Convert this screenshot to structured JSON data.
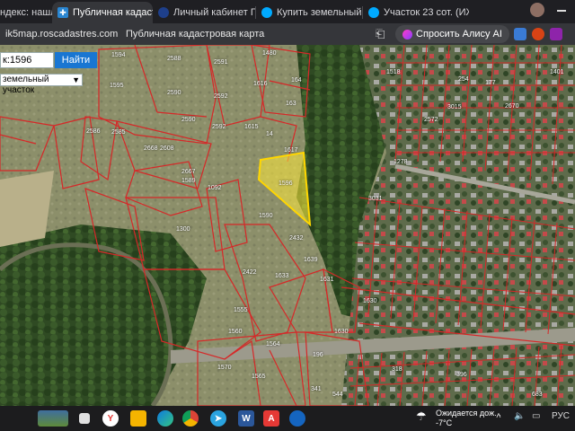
{
  "browser": {
    "tabs": [
      {
        "label": "ндекс: нашл",
        "active": false
      },
      {
        "label": "Публичная кадаст",
        "active": true
      },
      {
        "label": "Личный кабинет ПА",
        "active": false
      },
      {
        "label": "Купить земельный у",
        "active": false
      },
      {
        "label": "Участок 23 сот. (ИЖ",
        "active": false
      }
    ],
    "url": "ik5map.roscadastres.com",
    "page_title": "Публичная кадастровая карта",
    "alice_label": "Спросить Алису AI"
  },
  "search": {
    "value": "к:1596",
    "button": "Найти",
    "select_value": "земельный участок"
  },
  "map": {
    "highlight_label": "1596",
    "parcel_labels": [
      {
        "t": "1594"
      },
      {
        "t": "1595"
      },
      {
        "t": "2588"
      },
      {
        "t": "2591"
      },
      {
        "t": "1480"
      },
      {
        "t": "164"
      },
      {
        "t": "2590"
      },
      {
        "t": "2592"
      },
      {
        "t": "1616"
      },
      {
        "t": "163"
      },
      {
        "t": "2590"
      },
      {
        "t": "2592"
      },
      {
        "t": "1615"
      },
      {
        "t": "14"
      },
      {
        "t": "1617"
      },
      {
        "t": "2586"
      },
      {
        "t": "2585"
      },
      {
        "t": "2668"
      },
      {
        "t": "2608"
      },
      {
        "t": "2667"
      },
      {
        "t": "1589"
      },
      {
        "t": "1092"
      },
      {
        "t": "1590"
      },
      {
        "t": "1300"
      },
      {
        "t": "2432"
      },
      {
        "t": "1639"
      },
      {
        "t": "1633"
      },
      {
        "t": "1631"
      },
      {
        "t": "1630"
      },
      {
        "t": "2422"
      },
      {
        "t": "1555"
      },
      {
        "t": "1560"
      },
      {
        "t": "1564"
      },
      {
        "t": "1570"
      },
      {
        "t": "1565"
      },
      {
        "t": "196"
      },
      {
        "t": "1518"
      },
      {
        "t": "1401"
      },
      {
        "t": "254"
      },
      {
        "t": "177"
      },
      {
        "t": "2670"
      },
      {
        "t": "3015"
      },
      {
        "t": "2572"
      },
      {
        "t": "1278"
      },
      {
        "t": "3031"
      },
      {
        "t": "1630"
      },
      {
        "t": "318"
      },
      {
        "t": "396"
      },
      {
        "t": "683"
      },
      {
        "t": "341"
      },
      {
        "t": "544"
      }
    ]
  },
  "taskbar": {
    "weather_title": "Ожидается дож...",
    "weather_temp": "-7°C",
    "lang": "РУС"
  }
}
